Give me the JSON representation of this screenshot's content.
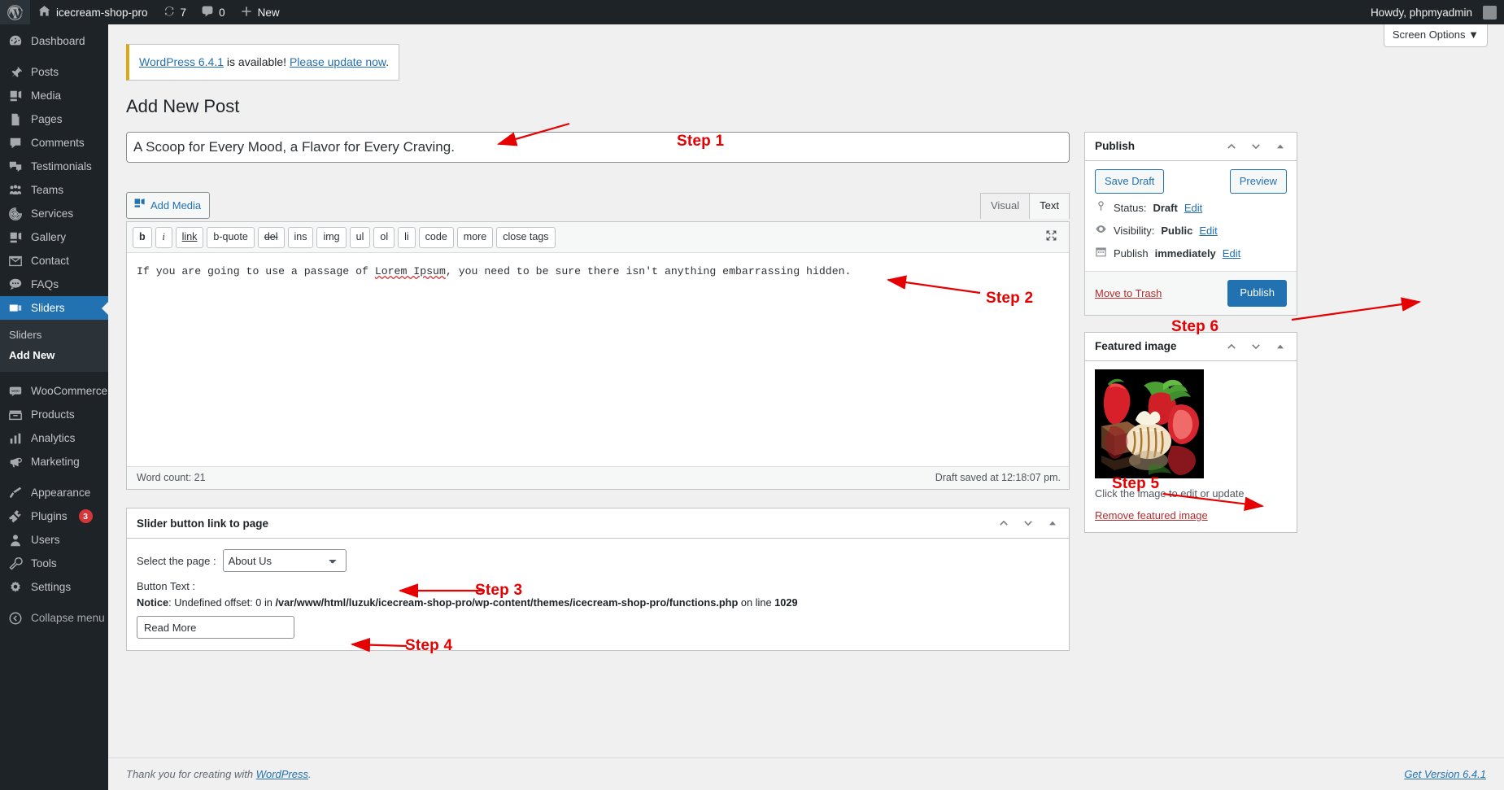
{
  "adminbar": {
    "logo_icon": "wordpress-logo-icon",
    "site_name": "icecream-shop-pro",
    "home_icon": "home-icon",
    "updates_icon": "updates-icon",
    "updates_count": "7",
    "comments_icon": "comment-bubble-icon",
    "comments_count": "0",
    "new_icon": "plus-icon",
    "new_label": "New",
    "howdy": "Howdy, phpmyadmin"
  },
  "screen_options": {
    "label": "Screen Options",
    "caret": "▼"
  },
  "sidebar": {
    "items": [
      {
        "label": "Dashboard",
        "icon": "dashboard-icon",
        "current": false
      },
      {
        "label": "Posts",
        "icon": "pin-icon",
        "current": false
      },
      {
        "label": "Media",
        "icon": "media-icon",
        "current": false
      },
      {
        "label": "Pages",
        "icon": "pages-icon",
        "current": false
      },
      {
        "label": "Comments",
        "icon": "comment-icon",
        "current": false
      },
      {
        "label": "Testimonials",
        "icon": "testimonials-icon",
        "current": false
      },
      {
        "label": "Teams",
        "icon": "teams-icon",
        "current": false
      },
      {
        "label": "Services",
        "icon": "services-icon",
        "current": false
      },
      {
        "label": "Gallery",
        "icon": "gallery-icon",
        "current": false
      },
      {
        "label": "Contact",
        "icon": "envelope-icon",
        "current": false
      },
      {
        "label": "FAQs",
        "icon": "faq-icon",
        "current": false
      },
      {
        "label": "Sliders",
        "icon": "sliders-icon",
        "current": true
      }
    ],
    "submenu": [
      {
        "label": "Sliders",
        "current": false
      },
      {
        "label": "Add New",
        "current": true
      }
    ],
    "items2": [
      {
        "label": "WooCommerce",
        "icon": "woocommerce-icon",
        "badge": ""
      },
      {
        "label": "Products",
        "icon": "products-icon",
        "badge": ""
      },
      {
        "label": "Analytics",
        "icon": "analytics-icon",
        "badge": ""
      },
      {
        "label": "Marketing",
        "icon": "marketing-icon",
        "badge": ""
      }
    ],
    "items3": [
      {
        "label": "Appearance",
        "icon": "appearance-icon",
        "badge": ""
      },
      {
        "label": "Plugins",
        "icon": "plugins-icon",
        "badge": "3"
      },
      {
        "label": "Users",
        "icon": "users-icon",
        "badge": ""
      },
      {
        "label": "Tools",
        "icon": "tools-icon",
        "badge": ""
      },
      {
        "label": "Settings",
        "icon": "settings-icon",
        "badge": ""
      }
    ],
    "collapse": {
      "label": "Collapse menu",
      "icon": "collapse-icon"
    }
  },
  "notice": {
    "link_version": "WordPress 6.4.1",
    "text_middle": " is available! ",
    "link_update": "Please update now",
    "text_end": "."
  },
  "page_title": "Add New Post",
  "editor": {
    "title_value": "A Scoop for Every Mood, a Flavor for Every Craving.",
    "title_placeholder": "Add title",
    "add_media_label": "Add Media",
    "add_media_icon": "add-media-icon",
    "tabs": [
      {
        "label": "Visual",
        "active": false
      },
      {
        "label": "Text",
        "active": true
      }
    ],
    "quicktags": [
      "b",
      "i",
      "link",
      "b-quote",
      "del",
      "ins",
      "img",
      "ul",
      "ol",
      "li",
      "code",
      "more",
      "close tags"
    ],
    "fullscreen_icon": "fullscreen-icon",
    "content_part1": "If you are going to use a passage of ",
    "content_spell": "Lorem Ipsum",
    "content_part2": ", you need to be sure there isn't anything embarrassing hidden.",
    "word_count": "Word count: 21",
    "draft_saved": "Draft saved at 12:18:07 pm."
  },
  "slider_metabox": {
    "title": "Slider button link to page",
    "select_label": "Select the page :",
    "select_value": "About Us",
    "select_options": [
      "About Us"
    ],
    "button_text_label": "Button Text :",
    "notice_prefix": "Notice",
    "notice_mid": ": Undefined offset: 0 in ",
    "notice_path": "/var/www/html/luzuk/icecream-shop-pro/wp-content/themes/icecream-shop-pro/functions.php",
    "notice_line_text": " on line ",
    "notice_line": "1029",
    "button_text_value": "Read More",
    "handle_up_icon": "chevron-up-icon",
    "handle_down_icon": "chevron-down-icon",
    "handle_toggle_icon": "toggle-icon"
  },
  "publish_panel": {
    "title": "Publish",
    "save_draft": "Save Draft",
    "preview": "Preview",
    "status_icon": "post-status-icon",
    "status_label": "Status:",
    "status_value": "Draft",
    "status_edit": "Edit",
    "visibility_icon": "eye-icon",
    "visibility_label": "Visibility:",
    "visibility_value": "Public",
    "visibility_edit": "Edit",
    "schedule_icon": "calendar-icon",
    "schedule_label": "Publish",
    "schedule_value": "immediately",
    "schedule_edit": "Edit",
    "move_to_trash": "Move to Trash",
    "publish_button": "Publish",
    "handle_up_icon": "chevron-up-icon",
    "handle_down_icon": "chevron-down-icon",
    "handle_toggle_icon": "toggle-icon"
  },
  "featured_panel": {
    "title": "Featured image",
    "thumb_alt": "strawberries-and-chocolate-thumbnail",
    "caption": "Click the image to edit or update",
    "remove_label": "Remove featured image",
    "handle_up_icon": "chevron-up-icon",
    "handle_down_icon": "chevron-down-icon",
    "handle_toggle_icon": "toggle-icon"
  },
  "footer": {
    "thanks_pre": "Thank you for creating with ",
    "thanks_link": "WordPress",
    "thanks_post": ".",
    "version": "Get Version 6.4.1"
  },
  "annotations": [
    {
      "label": "Step 1"
    },
    {
      "label": "Step 2"
    },
    {
      "label": "Step 3"
    },
    {
      "label": "Step 4"
    },
    {
      "label": "Step 5"
    },
    {
      "label": "Step 6"
    }
  ],
  "colors": {
    "admin_dark": "#1d2327",
    "accent_blue": "#2271b1",
    "annotation_red": "#e60000",
    "badge_red": "#d63638",
    "notice_yellow": "#dba617"
  }
}
